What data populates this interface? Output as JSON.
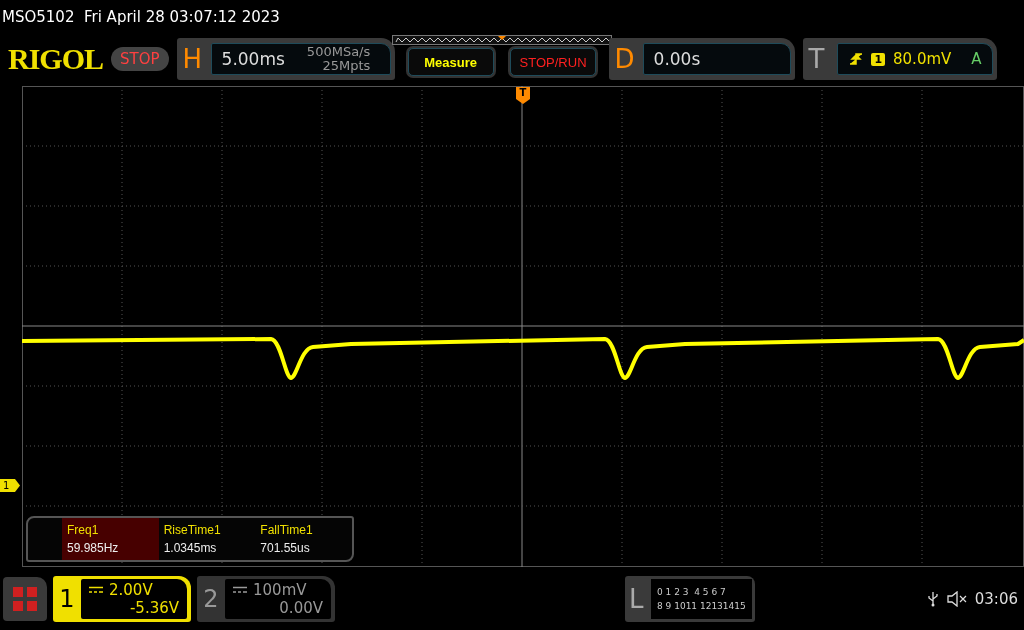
{
  "title_line": "MSO5102  Fri April 28 03:07:12 2023",
  "toolbar": {
    "logo": "RIGOL",
    "run_state": "STOP",
    "horizontal": {
      "letter": "H",
      "timebase": "5.00ms",
      "sample_rate": "500MSa/s",
      "memory_depth": "25Mpts"
    },
    "buttons": [
      {
        "label": "Measure",
        "kind": "menu"
      },
      {
        "label": "STOP/RUN",
        "kind": "run"
      }
    ],
    "delay": {
      "letter": "D",
      "value": "0.00s"
    },
    "trigger": {
      "letter": "T",
      "source": "1",
      "level": "80.0mV",
      "mode": "A"
    }
  },
  "screen": {
    "trigger_marker": "T",
    "channel_marker": "1",
    "measurements": [
      {
        "label": "Freq1",
        "value": "59.985Hz",
        "selected": true
      },
      {
        "label": "RiseTime1",
        "value": "1.0345ms",
        "selected": false
      },
      {
        "label": "FallTime1",
        "value": "701.55us",
        "selected": false
      }
    ]
  },
  "bottom_bar": {
    "channels": [
      {
        "number": "1",
        "scale": "2.00V",
        "offset": "-5.36V",
        "active": true
      },
      {
        "number": "2",
        "scale": "100mV",
        "offset": "0.00V",
        "active": false
      }
    ],
    "logic": {
      "letter": "L",
      "rows": [
        "0 1 2 3  4 5 6 7",
        "8 9 1011 12131415"
      ]
    },
    "time": "03:06"
  }
}
